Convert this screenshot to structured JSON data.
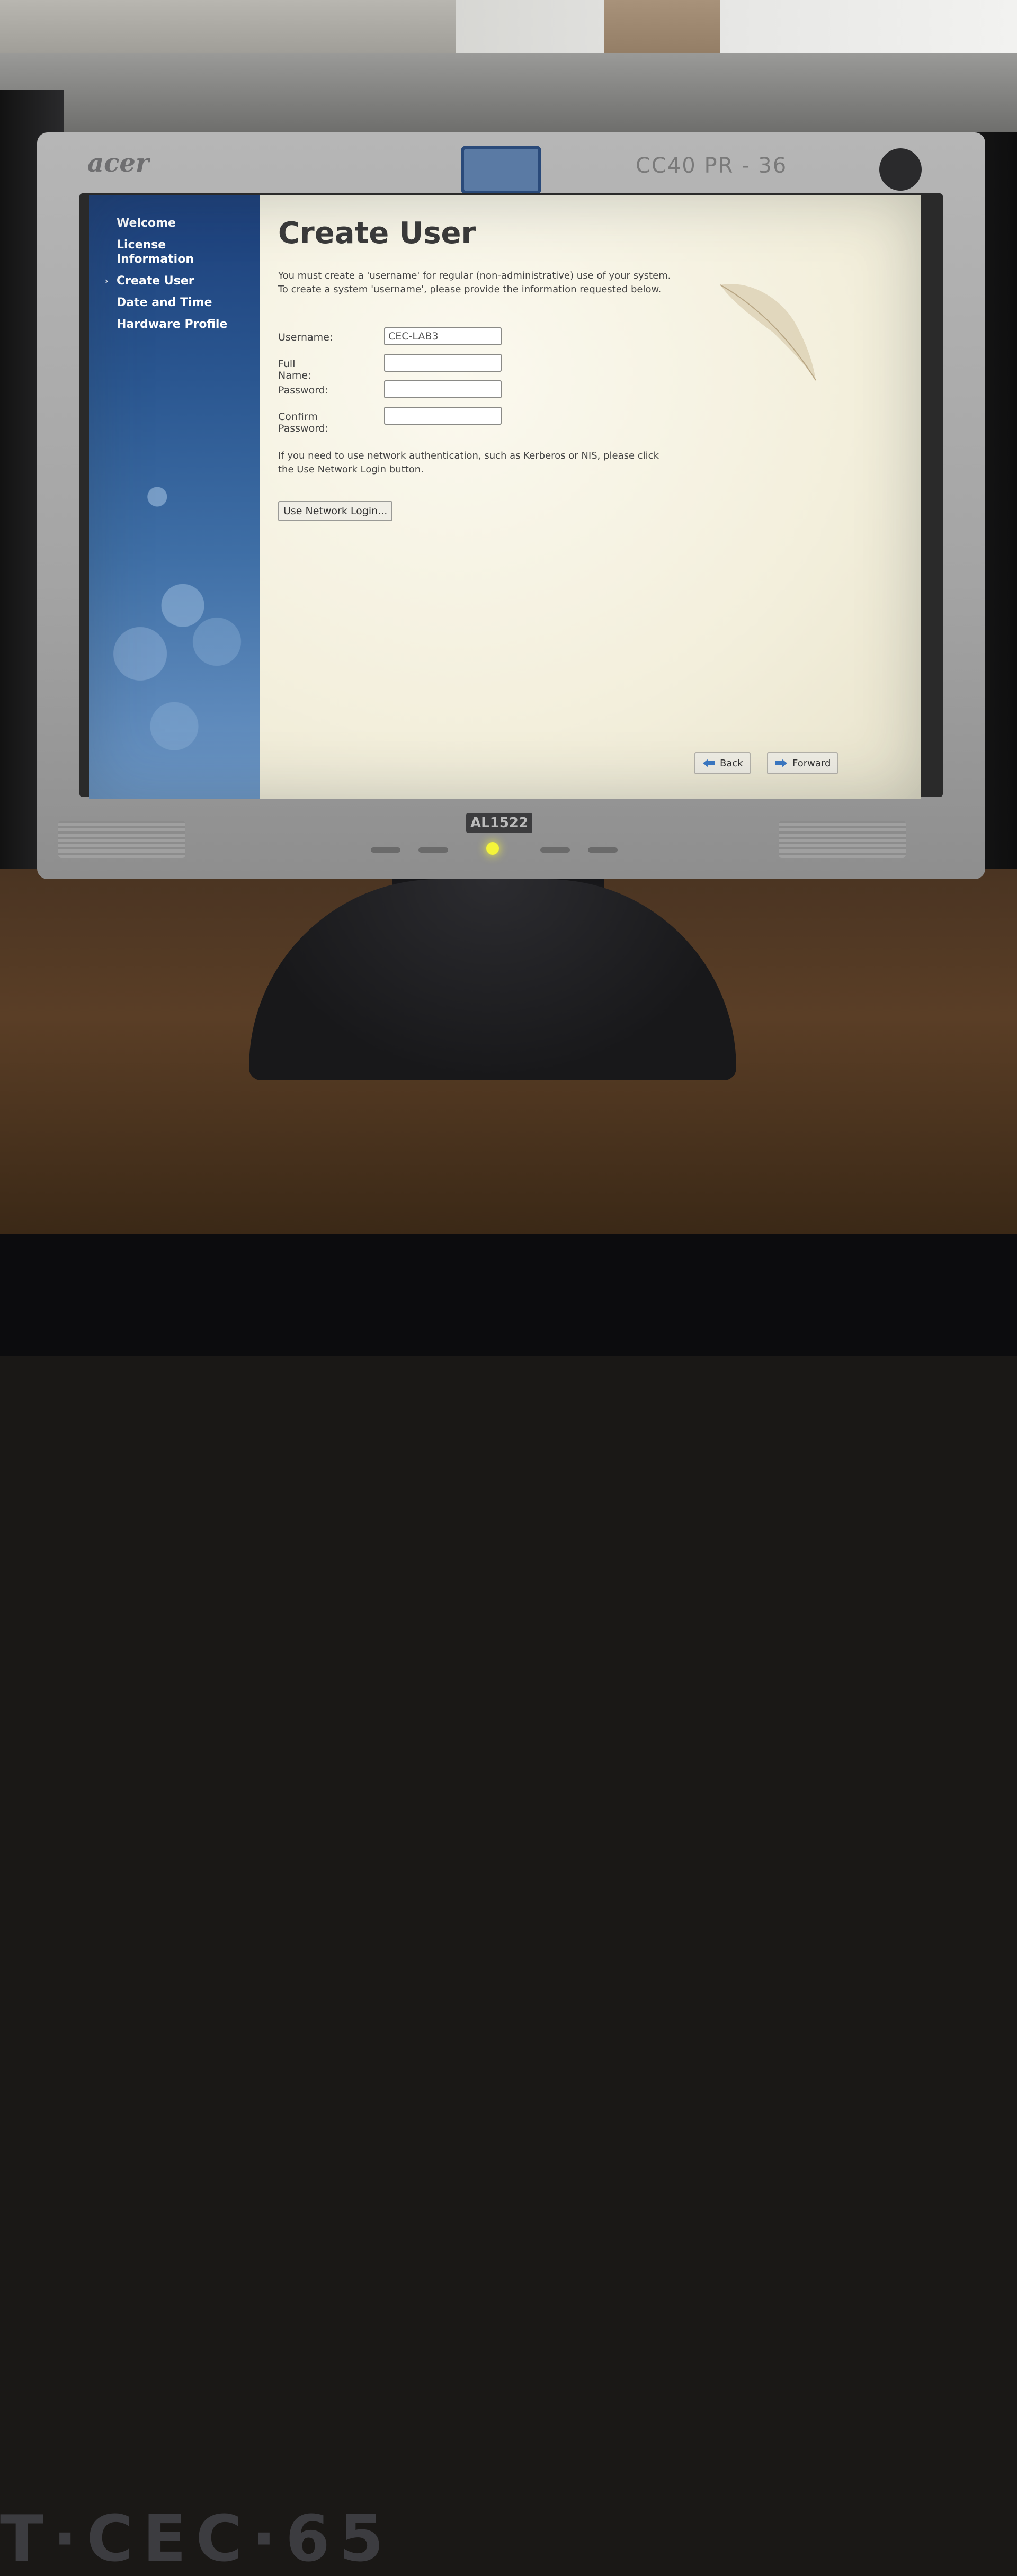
{
  "monitor": {
    "brand": "acer",
    "bezel_label": "CC40 PR - 36",
    "model": "AL1522",
    "desk_tag": "T·CEC·65"
  },
  "sidebar": {
    "items": [
      {
        "label": "Welcome",
        "active": false
      },
      {
        "label": "License Information",
        "active": false
      },
      {
        "label": "Create User",
        "active": true
      },
      {
        "label": "Date and Time",
        "active": false
      },
      {
        "label": "Hardware Profile",
        "active": false
      }
    ]
  },
  "main": {
    "title": "Create User",
    "intro": "You must create a 'username' for regular (non-administrative) use of your system.  To create a system 'username', please provide the information requested below.",
    "fields": {
      "username": {
        "label": "Username:",
        "value": "CEC-LAB3"
      },
      "fullname": {
        "label": "Full Name:",
        "value": ""
      },
      "password": {
        "label": "Password:",
        "value": ""
      },
      "confirm": {
        "label": "Confirm Password:",
        "value": ""
      }
    },
    "network_note": "If you need to use network authentication, such as Kerberos or NIS, please click the Use Network Login button.",
    "network_button": "Use Network Login..."
  },
  "nav": {
    "back_label": "Back",
    "forward_label": "Forward"
  },
  "colors": {
    "sidebar_top": "#1c3f7a",
    "sidebar_bottom": "#6c96c4",
    "content_bg": "#f4f1e4",
    "arrow_blue": "#3a78c4",
    "led": "#f4f43a"
  },
  "icons": [
    "chevron-right-icon",
    "back-arrow-icon",
    "forward-arrow-icon",
    "feather-icon",
    "text-cursor-icon"
  ]
}
